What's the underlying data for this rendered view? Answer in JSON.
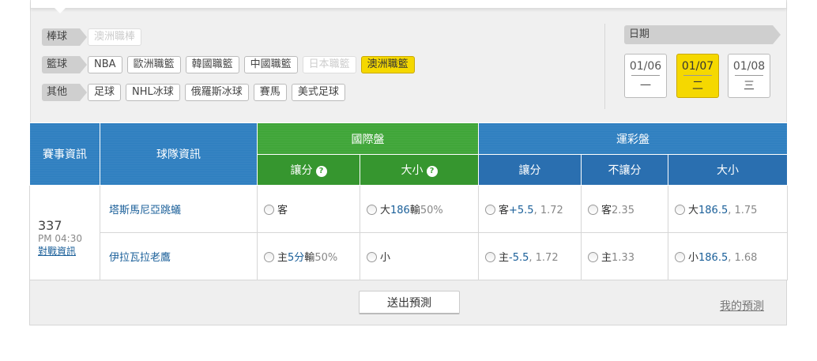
{
  "filters": {
    "rows": [
      {
        "label": "棒球",
        "items": [
          {
            "text": "澳洲職棒",
            "state": "disabled"
          }
        ]
      },
      {
        "label": "籃球",
        "items": [
          {
            "text": "NBA",
            "state": "normal"
          },
          {
            "text": "歐洲職籃",
            "state": "normal"
          },
          {
            "text": "韓國職籃",
            "state": "normal"
          },
          {
            "text": "中國職籃",
            "state": "normal"
          },
          {
            "text": "日本職籃",
            "state": "disabled"
          },
          {
            "text": "澳洲職籃",
            "state": "active"
          }
        ]
      },
      {
        "label": "其他",
        "items": [
          {
            "text": "足球",
            "state": "normal"
          },
          {
            "text": "NHL冰球",
            "state": "normal"
          },
          {
            "text": "俄羅斯冰球",
            "state": "normal"
          },
          {
            "text": "賽馬",
            "state": "normal"
          },
          {
            "text": "美式足球",
            "state": "normal"
          }
        ]
      }
    ],
    "date_label": "日期",
    "dates": [
      {
        "date": "01/06",
        "weekday": "一",
        "active": false
      },
      {
        "date": "01/07",
        "weekday": "二",
        "active": true
      },
      {
        "date": "01/08",
        "weekday": "三",
        "active": false
      }
    ]
  },
  "table": {
    "headers": {
      "event_info": "賽事資訊",
      "team_info": "球隊資訊",
      "international": "國際盤",
      "sports_lottery": "運彩盤",
      "spread": "讓分",
      "over_under": "大小",
      "lottery_spread": "讓分",
      "moneyline": "不讓分",
      "lottery_over_under": "大小"
    },
    "help_icon": "?",
    "match": {
      "id": "337",
      "time": "PM 04:30",
      "link": "對戰資訊",
      "away": {
        "team": "塔斯馬尼亞跳蟻",
        "intl_spread": {
          "side": "客"
        },
        "intl_ou": {
          "side": "大",
          "line": "186",
          "result": "輸",
          "pct": "50%"
        },
        "lot_spread": {
          "side": "客",
          "line": "+5.5",
          "odds": ", 1.72"
        },
        "lot_money": {
          "side": "客",
          "odds": "2.35"
        },
        "lot_ou": {
          "side": "大",
          "line": "186.5",
          "odds": ", 1.75"
        }
      },
      "home": {
        "team": "伊拉瓦拉老鷹",
        "intl_spread": {
          "side": "主",
          "line": "5分",
          "result": "輸",
          "pct": "50%"
        },
        "intl_ou": {
          "side": "小"
        },
        "lot_spread": {
          "side": "主",
          "line": "-5.5",
          "odds": ", 1.72"
        },
        "lot_money": {
          "side": "主",
          "odds": "1.33"
        },
        "lot_ou": {
          "side": "小",
          "line": "186.5",
          "odds": ", 1.68"
        }
      }
    }
  },
  "footer": {
    "submit": "送出預測",
    "my_predictions": "我的預測"
  },
  "colors": {
    "accent_yellow": "#f5d800",
    "header_blue": "#2f7fc0",
    "header_green": "#3ea537",
    "link_blue": "#1a5f99"
  }
}
